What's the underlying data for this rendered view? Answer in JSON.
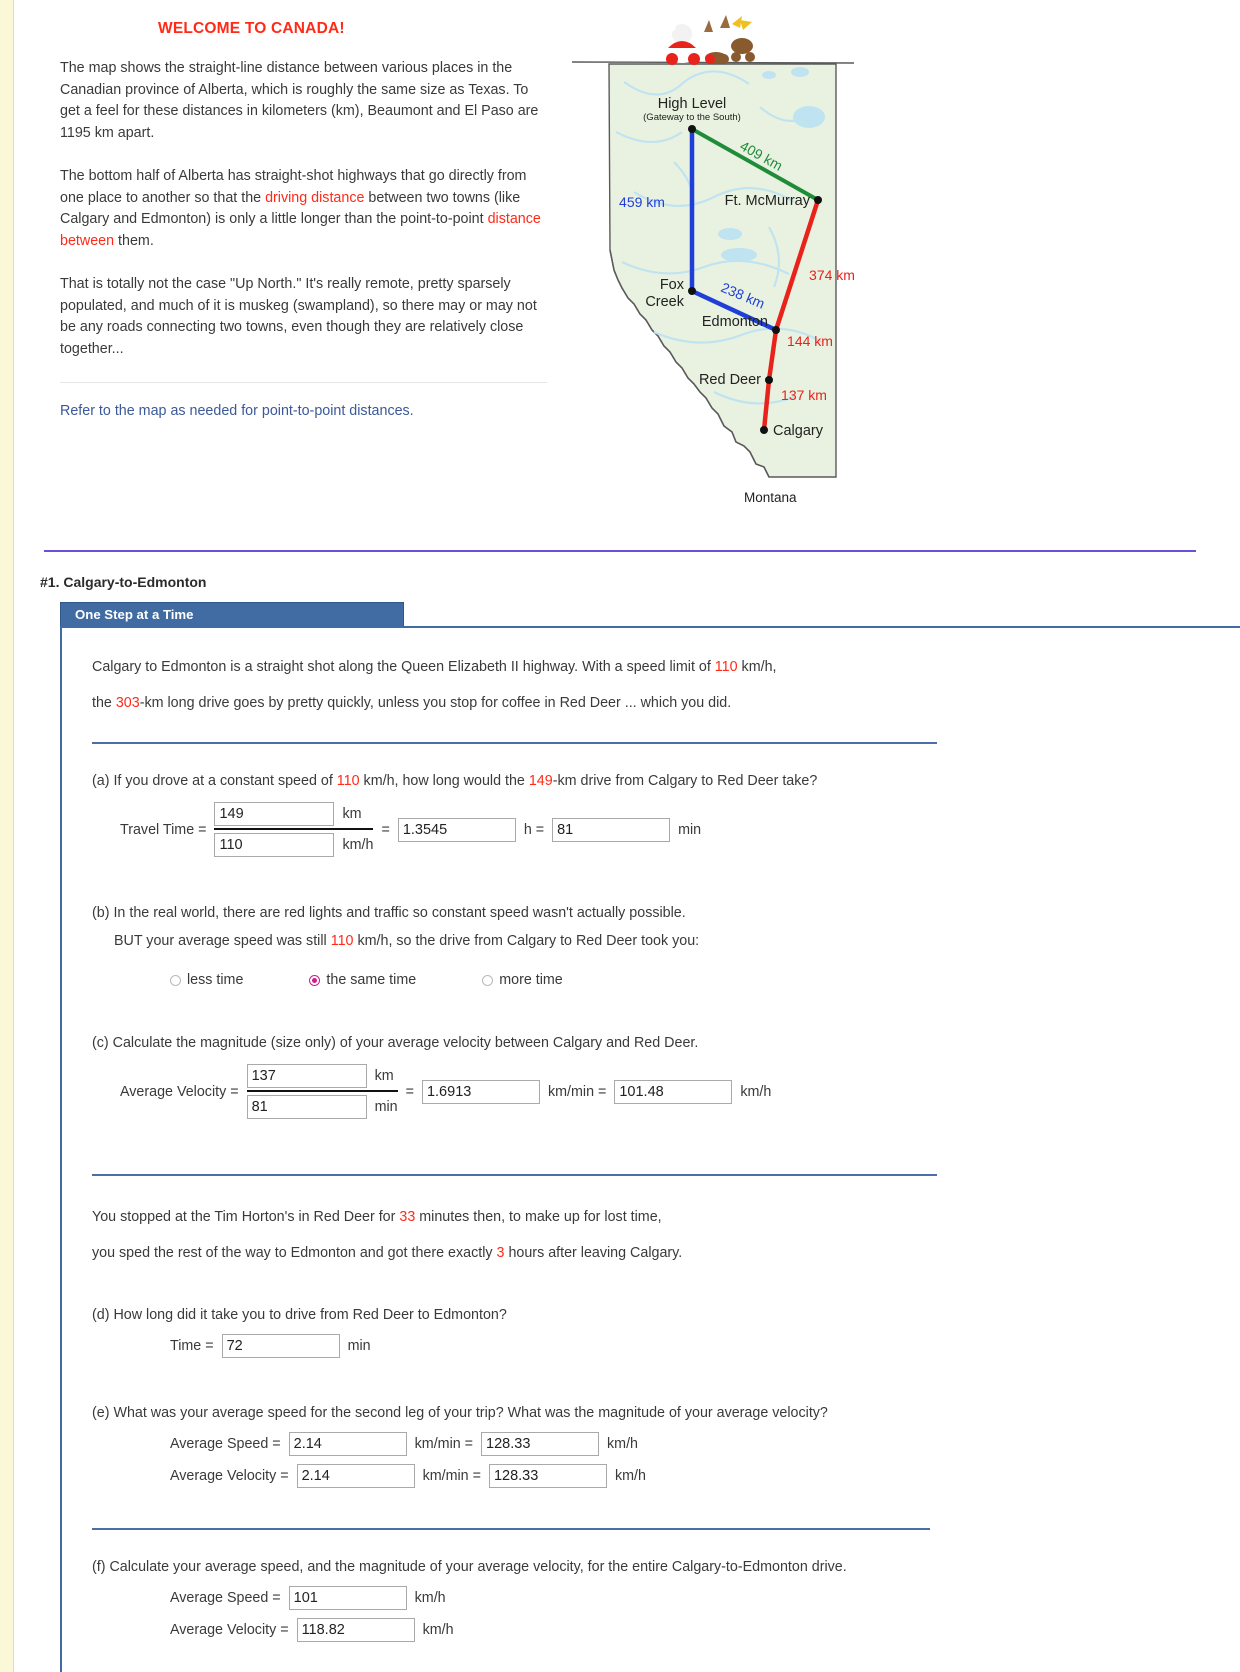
{
  "intro": {
    "welcome_title": "WELCOME TO CANADA!",
    "p1_a": "The map shows the straight-line distance between various places in the Canadian province of Alberta, which is roughly the same size as Texas. To get a feel for these distances in kilometers (km), Beaumont and El Paso are 1195 km apart.",
    "p2_a": "The bottom half of Alberta has straight-shot highways that go directly from one place to another so that the ",
    "p2_red1": "driving distance",
    "p2_b": " between two towns (like Calgary and Edmonton) is only a little longer than the point-to-point ",
    "p2_red2": "distance between",
    "p2_c": " them.",
    "p3": "That is totally not the case \"Up North.\" It's really remote, pretty sparsely populated, and much of it is muskeg (swampland), so there may or may not be any roads connecting two towns, even though they are relatively close together...",
    "refer": "Refer to the map as needed for point-to-point distances."
  },
  "map": {
    "caption": "Montana",
    "cities": [
      {
        "name": "High Level",
        "sub": "(Gateway to the South)"
      },
      {
        "name": "Ft. McMurray",
        "sub": ""
      },
      {
        "name": "Fox",
        "sub": "Creek"
      },
      {
        "name": "Edmonton",
        "sub": ""
      },
      {
        "name": "Red Deer",
        "sub": ""
      },
      {
        "name": "Calgary",
        "sub": ""
      }
    ],
    "labels": {
      "high_level": "High Level",
      "high_level_sub": "(Gateway to the South)",
      "ft_mcmurray": "Ft. McMurray",
      "fox": "Fox",
      "creek": "Creek",
      "edmonton": "Edmonton",
      "red_deer": "Red Deer",
      "calgary": "Calgary"
    },
    "distances": {
      "high_level_to_ft_mcmurray": "409 km",
      "high_level_to_fox_creek": "459 km",
      "fox_creek_to_edmonton": "238 km",
      "ft_mcmurray_to_edmonton": "374 km",
      "edmonton_to_red_deer": "144 km",
      "red_deer_to_calgary": "137 km"
    },
    "colors": {
      "blue": "#1f3fd8",
      "red": "#e8231c",
      "green": "#1f8c3a",
      "land": "#e9f2e0",
      "water": "#bfe3f0",
      "outline": "#5a5a5a"
    }
  },
  "question": {
    "number_title": "#1. Calgary-to-Edmonton",
    "tab_label": "One Step at a Time",
    "lead_a": "Calgary to Edmonton is a straight shot along the Queen Elizabeth II highway. With a speed limit of ",
    "lead_speed": "110",
    "lead_b": " km/h,",
    "lead_c": "the ",
    "lead_dist": "303",
    "lead_d": "-km long drive goes by pretty quickly, unless you stop for coffee in Red Deer ... which you did."
  },
  "part_a": {
    "text_1": "(a) If you drove at a constant speed of ",
    "speed": "110",
    "text_2": " km/h, how long would the ",
    "distance": "149",
    "text_3": "-km drive from Calgary to Red Deer take?",
    "label": "Travel Time =",
    "numerator_value": "149",
    "numerator_unit": "km",
    "denominator_value": "110",
    "denominator_unit": "km/h",
    "result_hours": "1.3545",
    "hours_unit": "h =",
    "result_minutes": "81",
    "minutes_unit": "min"
  },
  "part_b": {
    "text_1": "(b) In the real world, there are red lights and traffic so constant speed wasn't actually possible.",
    "text_2a": "BUT your average speed was still ",
    "speed": "110",
    "text_2b": " km/h, so the drive from Calgary to Red Deer took you:",
    "options": [
      {
        "label": "less time",
        "selected": false
      },
      {
        "label": "the same time",
        "selected": true
      },
      {
        "label": "more time",
        "selected": false
      }
    ]
  },
  "part_c": {
    "text": "(c) Calculate the magnitude (size only) of your average velocity between Calgary and Red Deer.",
    "label": "Average Velocity =",
    "numerator_value": "137",
    "numerator_unit": "km",
    "denominator_value": "81",
    "denominator_unit": "min",
    "result_kmmin": "1.6913",
    "kmmin_unit": "km/min =",
    "result_kmh": "101.48",
    "kmh_unit": "km/h"
  },
  "interlude": {
    "line1a": "You stopped at the Tim Horton's in Red Deer for ",
    "minutes": "33",
    "line1b": " minutes then, to make up for lost time,",
    "line2a": "you sped the rest of the way to Edmonton and got there exactly ",
    "hours": "3",
    "line2b": " hours after leaving Calgary."
  },
  "part_d": {
    "text": "(d) How long did it take you to drive from Red Deer to Edmonton?",
    "label": "Time =",
    "value": "72",
    "unit": "min"
  },
  "part_e": {
    "text": "(e) What was your average speed for the second leg of your trip? What was the magnitude of your average velocity?",
    "rows": [
      {
        "label": "Average Speed =",
        "value1": "2.14",
        "mid": "km/min =",
        "value2": "128.33",
        "end": "km/h"
      },
      {
        "label": "Average Velocity =",
        "value1": "2.14",
        "mid": "km/min =",
        "value2": "128.33",
        "end": "km/h"
      }
    ]
  },
  "part_f": {
    "text": "(f) Calculate your average speed, and the magnitude of your average velocity, for the entire Calgary-to-Edmonton drive.",
    "rows": [
      {
        "label": "Average Speed =",
        "value": "101",
        "unit": "km/h"
      },
      {
        "label": "Average Velocity =",
        "value": "118.82",
        "unit": "km/h"
      }
    ]
  }
}
